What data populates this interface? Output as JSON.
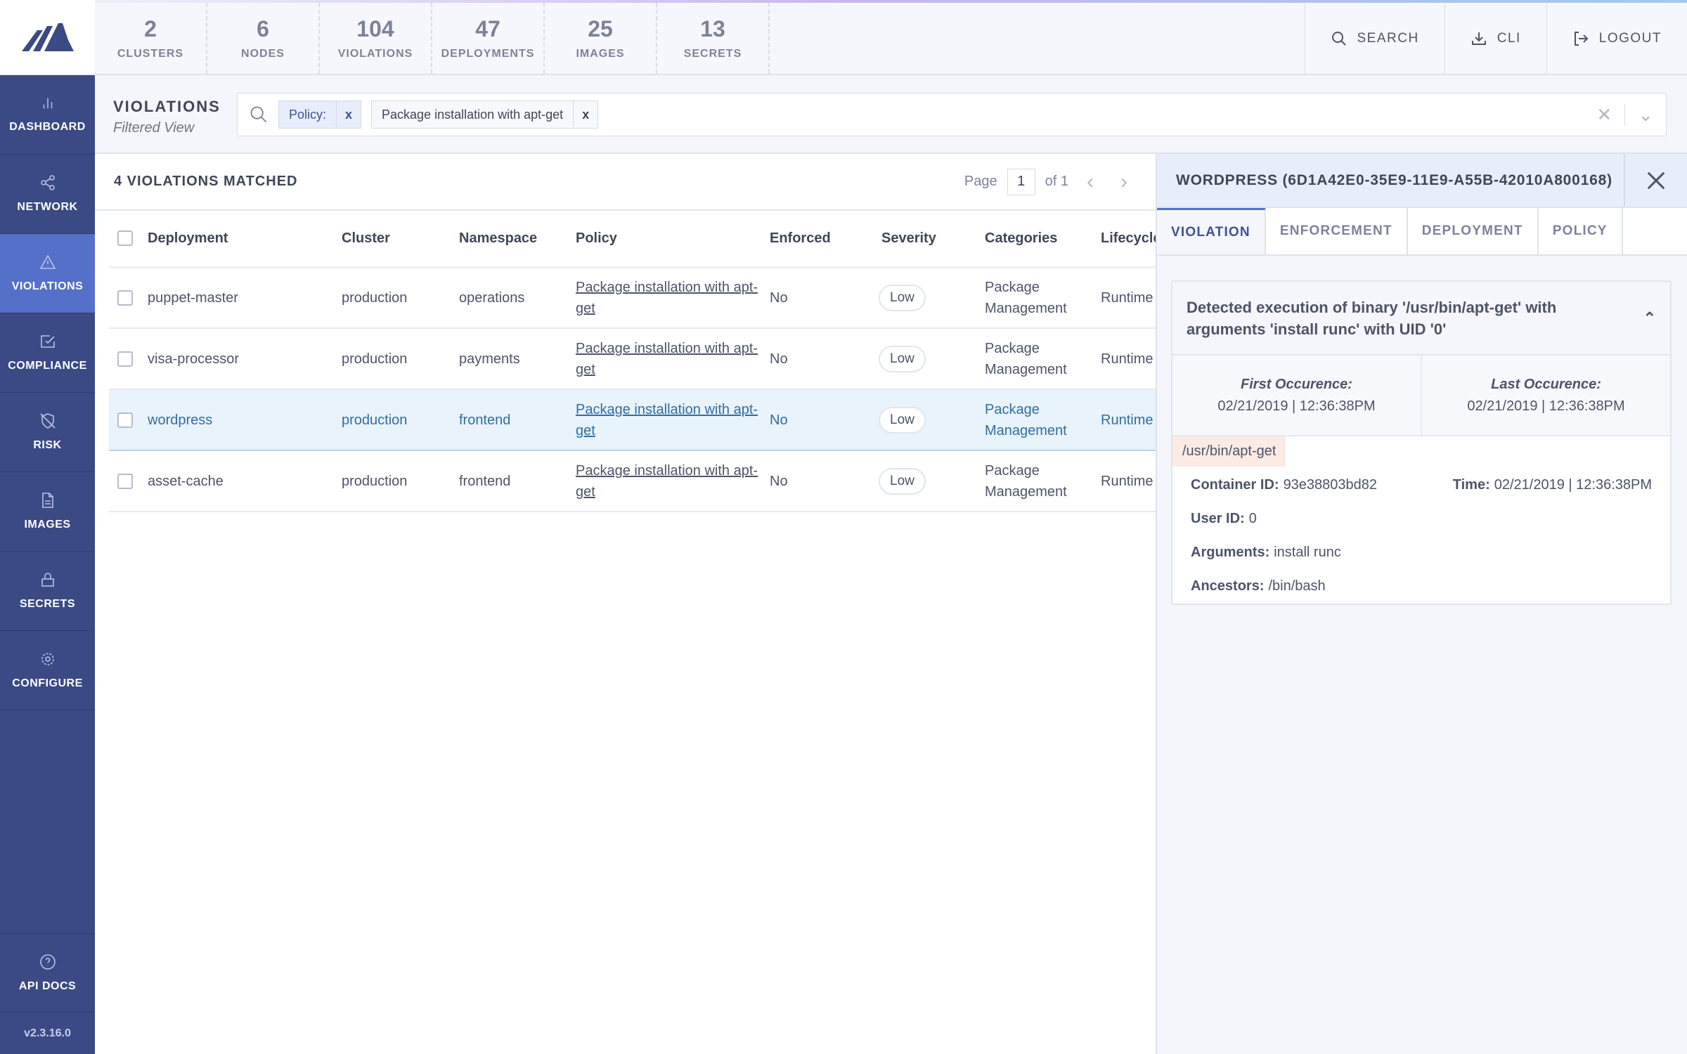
{
  "brand": {
    "accent": "#3b4a85",
    "active": "#5570c9"
  },
  "stats": [
    {
      "n": "2",
      "l": "CLUSTERS"
    },
    {
      "n": "6",
      "l": "NODES"
    },
    {
      "n": "104",
      "l": "VIOLATIONS"
    },
    {
      "n": "47",
      "l": "DEPLOYMENTS"
    },
    {
      "n": "25",
      "l": "IMAGES"
    },
    {
      "n": "13",
      "l": "SECRETS"
    }
  ],
  "topbar": {
    "search": "SEARCH",
    "cli": "CLI",
    "logout": "LOGOUT"
  },
  "sidebar": {
    "items": [
      {
        "label": "DASHBOARD",
        "icon": "bar-chart-icon"
      },
      {
        "label": "NETWORK",
        "icon": "share-icon"
      },
      {
        "label": "VIOLATIONS",
        "icon": "alert-triangle-icon",
        "active": true
      },
      {
        "label": "COMPLIANCE",
        "icon": "check-square-icon"
      },
      {
        "label": "RISK",
        "icon": "shield-off-icon"
      },
      {
        "label": "IMAGES",
        "icon": "file-icon"
      },
      {
        "label": "SECRETS",
        "icon": "lock-icon"
      },
      {
        "label": "CONFIGURE",
        "icon": "gear-icon"
      }
    ],
    "api_docs": "API DOCS",
    "version": "v2.3.16.0"
  },
  "page": {
    "title": "VIOLATIONS",
    "subtitle": "Filtered View"
  },
  "search": {
    "chips": [
      {
        "key": "Policy:"
      },
      {
        "value": "Package installation with apt-get"
      }
    ],
    "remove": "x"
  },
  "list": {
    "count": "4 VIOLATIONS MATCHED",
    "page_label": "Page",
    "page": "1",
    "of": "of 1",
    "columns": [
      "Deployment",
      "Cluster",
      "Namespace",
      "Policy",
      "Enforced",
      "Severity",
      "Categories",
      "Lifecycle"
    ],
    "rows": [
      {
        "deployment": "puppet-master",
        "cluster": "production",
        "namespace": "operations",
        "policy": "Package installation with apt-get",
        "enforced": "No",
        "severity": "Low",
        "categories": "Package Management",
        "lifecycle": "Runtime"
      },
      {
        "deployment": "visa-processor",
        "cluster": "production",
        "namespace": "payments",
        "policy": "Package installation with apt-get",
        "enforced": "No",
        "severity": "Low",
        "categories": "Package Management",
        "lifecycle": "Runtime"
      },
      {
        "deployment": "wordpress",
        "cluster": "production",
        "namespace": "frontend",
        "policy": "Package installation with apt-get",
        "enforced": "No",
        "severity": "Low",
        "categories": "Package Management",
        "lifecycle": "Runtime",
        "selected": true
      },
      {
        "deployment": "asset-cache",
        "cluster": "production",
        "namespace": "frontend",
        "policy": "Package installation with apt-get",
        "enforced": "No",
        "severity": "Low",
        "categories": "Package Management",
        "lifecycle": "Runtime"
      }
    ]
  },
  "panel": {
    "title": "WORDPRESS (6D1A42E0-35E9-11E9-A55B-42010A800168)",
    "tabs": [
      "VIOLATION",
      "ENFORCEMENT",
      "DEPLOYMENT",
      "POLICY"
    ],
    "message": "Detected execution of binary '/usr/bin/apt-get' with arguments 'install runc' with UID '0'",
    "first_label": "First Occurence:",
    "first": "02/21/2019 | 12:36:38PM",
    "last_label": "Last Occurence:",
    "last": "02/21/2019 | 12:36:38PM",
    "process": "/usr/bin/apt-get",
    "container_label": "Container ID:",
    "container": "93e38803bd82",
    "time_label": "Time:",
    "time": "02/21/2019 | 12:36:38PM",
    "user_label": "User ID:",
    "user": "0",
    "args_label": "Arguments:",
    "args": "install runc",
    "anc_label": "Ancestors:",
    "anc": "/bin/bash"
  }
}
